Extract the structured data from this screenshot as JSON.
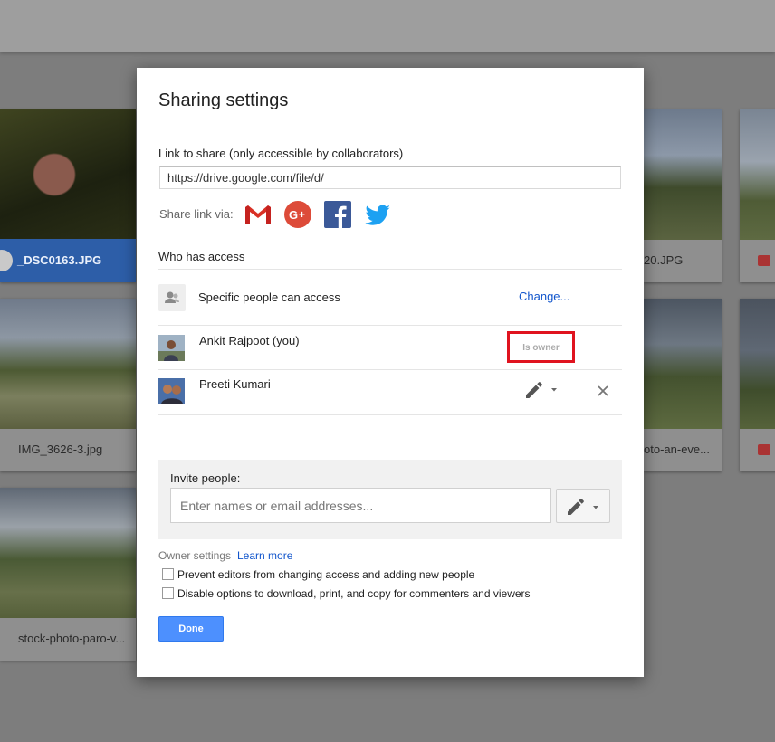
{
  "background": {
    "files": [
      {
        "name": "_DSC0163.JPG",
        "selected": true
      },
      {
        "name": "IMG_3626-3.jpg"
      },
      {
        "name": "stock-photo-paro-v..."
      },
      {
        "name": "20.JPG"
      },
      {
        "name": "oto-an-eve..."
      }
    ]
  },
  "dialog": {
    "title": "Sharing settings",
    "link_label": "Link to share (only accessible by collaborators)",
    "link_value": "https://drive.google.com/file/d/",
    "share_via_label": "Share link via:",
    "share_icons": [
      "gmail-icon",
      "google-plus-icon",
      "facebook-icon",
      "twitter-icon"
    ],
    "who_has_access": "Who has access",
    "access_level": "Specific people can access",
    "change_label": "Change...",
    "people": [
      {
        "name": "Ankit Rajpoot (you)",
        "role": "Is owner"
      },
      {
        "name": "Preeti Kumari",
        "role_icon": "pencil-icon"
      }
    ],
    "invite": {
      "label": "Invite people:",
      "placeholder": "Enter names or email addresses..."
    },
    "owner_settings_label": "Owner settings",
    "learn_more": "Learn more",
    "checkboxes": [
      {
        "label": "Prevent editors from changing access and adding new people",
        "checked": false
      },
      {
        "label": "Disable options to download, print, and copy for commenters and viewers",
        "checked": false
      }
    ],
    "done_label": "Done"
  },
  "colors": {
    "accent_blue": "#4d90fe",
    "link_blue": "#1155cc",
    "highlight_red": "#e0131f",
    "selected_card": "#2d5ea8"
  }
}
